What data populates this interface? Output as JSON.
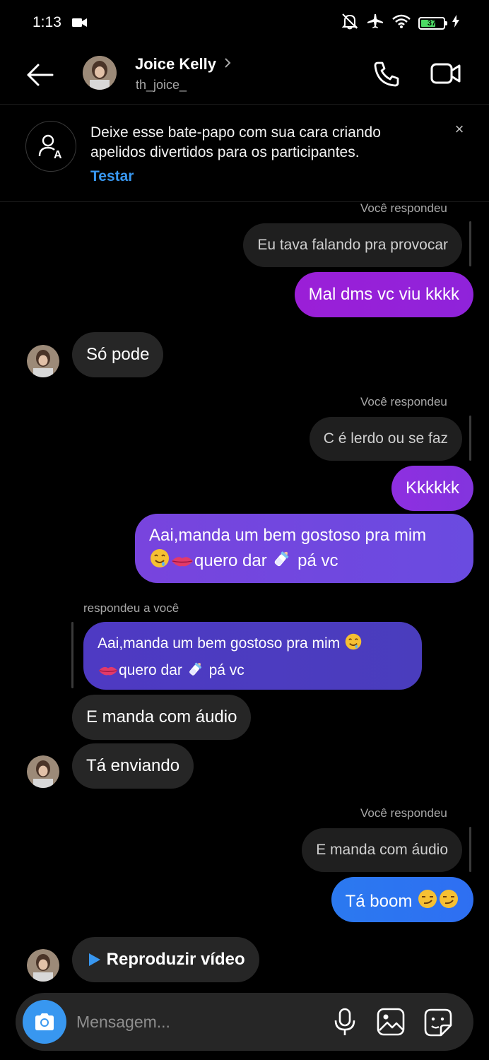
{
  "status_bar": {
    "time": "1:13",
    "battery": "37"
  },
  "header": {
    "name": "Joice Kelly",
    "username": "th_joice_"
  },
  "banner": {
    "text": "Deixe esse bate-papo com sua cara criando apelidos divertidos para os participantes.",
    "action": "Testar",
    "close": "×"
  },
  "messages": [
    {
      "id": "m1",
      "meta": "Você respondeu",
      "quote": "Eu tava falando pra provocar",
      "text": "Mal dms vc viu kkkk"
    },
    {
      "id": "m2",
      "text": "Só pode"
    },
    {
      "id": "m3",
      "meta": "Você respondeu",
      "quote": "C é lerdo ou se faz",
      "text": "Kkkkkk"
    },
    {
      "id": "m4",
      "text_line1": "Aai,manda um bem gostoso pra mim",
      "text_line2_a": "quero dar",
      "text_line2_b": "pá vc"
    },
    {
      "id": "m5",
      "meta": "respondeu a você",
      "quote_line1": "Aai,manda um bem gostoso pra mim",
      "quote_line2_a": "quero dar",
      "quote_line2_b": "pá vc"
    },
    {
      "id": "m6",
      "text": "E manda com áudio"
    },
    {
      "id": "m7",
      "text": "Tá enviando"
    },
    {
      "id": "m8",
      "meta": "Você respondeu",
      "quote": "E manda com áudio",
      "text": "Tá boom"
    },
    {
      "id": "m9",
      "text": "Reproduzir vídeo"
    }
  ],
  "composer": {
    "placeholder": "Mensagem..."
  },
  "colors": {
    "accent_blue": "#3897f0",
    "bubble_grey": "#262626",
    "purple": "#8f23da",
    "blue_bubble": "#2e6ff2"
  }
}
